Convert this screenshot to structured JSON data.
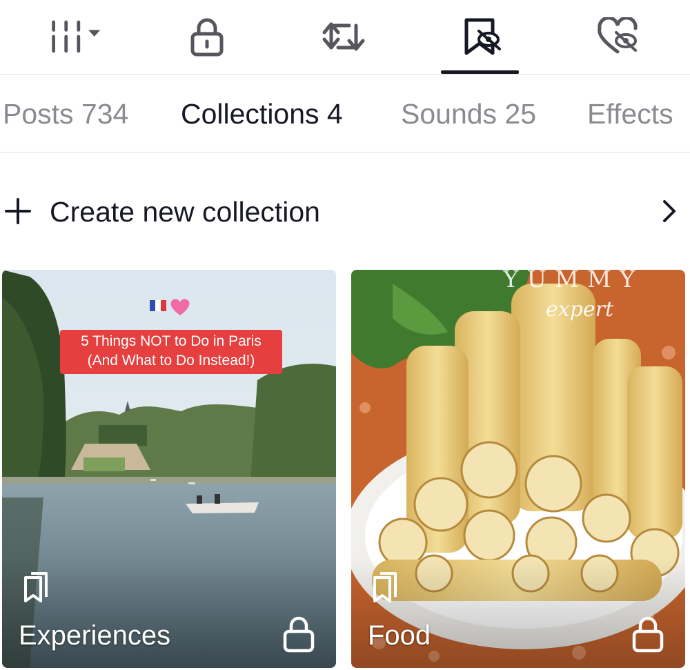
{
  "icon_bar": {
    "items": [
      {
        "icon": "grid-menu-icon",
        "selected": false
      },
      {
        "icon": "lock-icon",
        "selected": false
      },
      {
        "icon": "repost-icon",
        "selected": false
      },
      {
        "icon": "bookmark-hidden-icon",
        "selected": true
      },
      {
        "icon": "heart-hidden-icon",
        "selected": false
      }
    ]
  },
  "tabs": [
    {
      "label": "Posts 734",
      "active": false
    },
    {
      "label": "Collections 4",
      "active": true
    },
    {
      "label": "Sounds 25",
      "active": false
    },
    {
      "label": "Effects",
      "active": false
    }
  ],
  "create_collection": {
    "label": "Create new collection",
    "icon": "plus-icon",
    "chevron": "chevron-right-icon"
  },
  "collections": [
    {
      "name": "Experiences",
      "private": true,
      "thumbnail_caption_line1": "5 Things NOT to Do in Paris",
      "thumbnail_caption_line2": "(And What to Do Instead!)",
      "thumbnail_emoji": "🇫🇷💖"
    },
    {
      "name": "Food",
      "private": true,
      "thumbnail_watermark": "YUMMY",
      "thumbnail_watermark_sub": "expert"
    }
  ],
  "colors": {
    "text_primary": "#161823",
    "text_secondary": "#8a8b91",
    "divider": "#e3e3e4",
    "caption_red": "#e5403f"
  }
}
